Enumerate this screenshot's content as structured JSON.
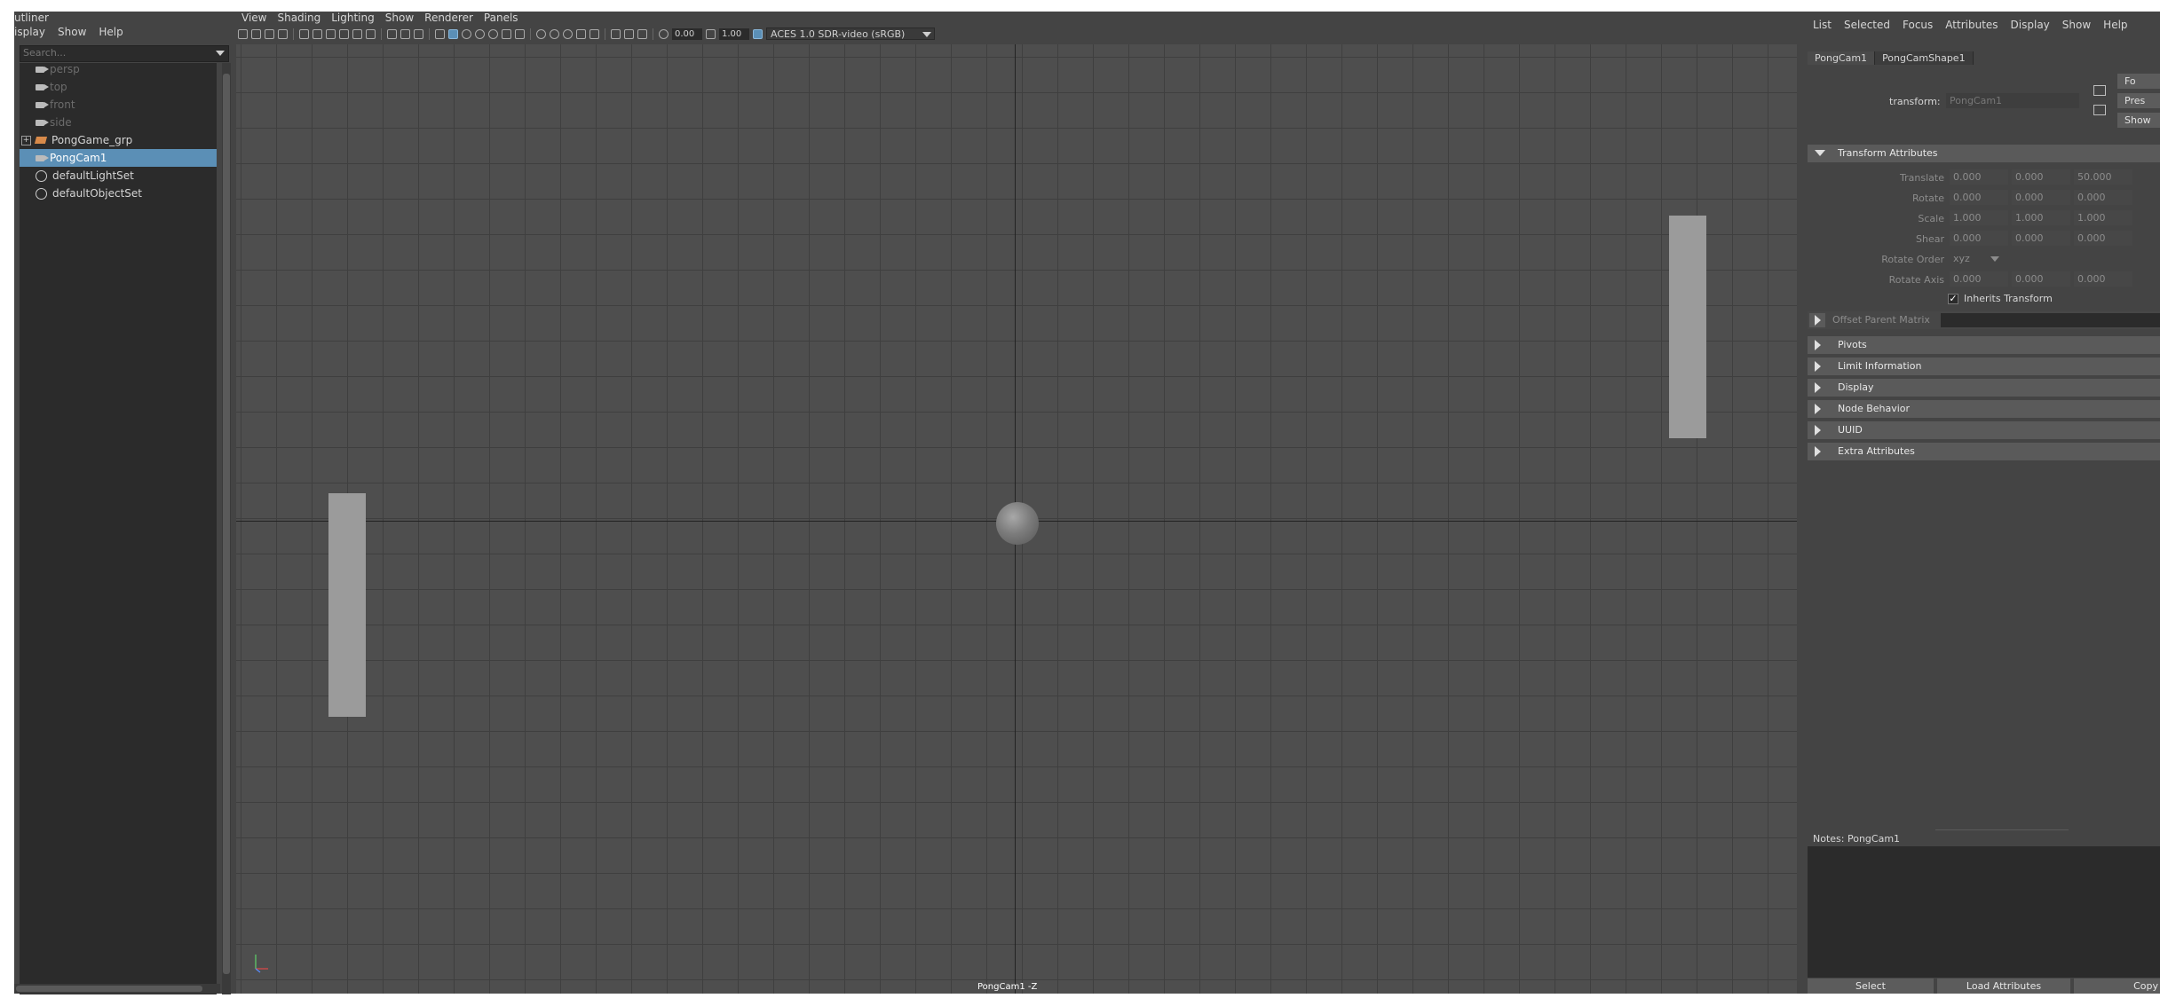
{
  "outliner": {
    "title": "utliner",
    "menu": [
      "isplay",
      "Show",
      "Help"
    ],
    "search_placeholder": "Search...",
    "items": [
      {
        "label": "persp",
        "icon": "camera-icon",
        "state": "dim"
      },
      {
        "label": "top",
        "icon": "camera-icon",
        "state": "dim"
      },
      {
        "label": "front",
        "icon": "camera-icon",
        "state": "dim"
      },
      {
        "label": "side",
        "icon": "camera-icon",
        "state": "dim"
      },
      {
        "label": "PongGame_grp",
        "icon": "group-icon",
        "state": "normal"
      },
      {
        "label": "PongCam1",
        "icon": "camera-icon",
        "state": "selected"
      },
      {
        "label": "defaultLightSet",
        "icon": "set-icon",
        "state": "normal"
      },
      {
        "label": "defaultObjectSet",
        "icon": "set-icon",
        "state": "normal"
      }
    ]
  },
  "viewport": {
    "menu": [
      "View",
      "Shading",
      "Lighting",
      "Show",
      "Renderer",
      "Panels"
    ],
    "toolbar": {
      "exposure": "0.00",
      "gamma": "1.00",
      "color_space": "ACES 1.0 SDR-video (sRGB)"
    },
    "camera_label": "PongCam1 -Z"
  },
  "attribute_editor": {
    "menu": [
      "List",
      "Selected",
      "Focus",
      "Attributes",
      "Display",
      "Show",
      "Help"
    ],
    "tabs": [
      "PongCam1",
      "PongCamShape1"
    ],
    "transform_label": "transform:",
    "transform_value": "PongCam1",
    "side_buttons": [
      "Fo",
      "Pres",
      "Show"
    ],
    "section_transform": "Transform Attributes",
    "rows": {
      "translate": {
        "label": "Translate",
        "values": [
          "0.000",
          "0.000",
          "50.000"
        ]
      },
      "rotate": {
        "label": "Rotate",
        "values": [
          "0.000",
          "0.000",
          "0.000"
        ]
      },
      "scale": {
        "label": "Scale",
        "values": [
          "1.000",
          "1.000",
          "1.000"
        ]
      },
      "shear": {
        "label": "Shear",
        "values": [
          "0.000",
          "0.000",
          "0.000"
        ]
      },
      "rotate_order": {
        "label": "Rotate Order",
        "value": "xyz"
      },
      "rotate_axis": {
        "label": "Rotate Axis",
        "values": [
          "0.000",
          "0.000",
          "0.000"
        ]
      }
    },
    "inherits_transform": {
      "label": "Inherits Transform",
      "checked": true
    },
    "offset_parent_matrix": "Offset Parent Matrix",
    "sections": [
      "Pivots",
      "Limit Information",
      "Display",
      "Node Behavior",
      "UUID",
      "Extra Attributes"
    ],
    "notes_label": "Notes:  PongCam1",
    "bottom_buttons": [
      "Select",
      "Load Attributes",
      "Copy"
    ]
  }
}
